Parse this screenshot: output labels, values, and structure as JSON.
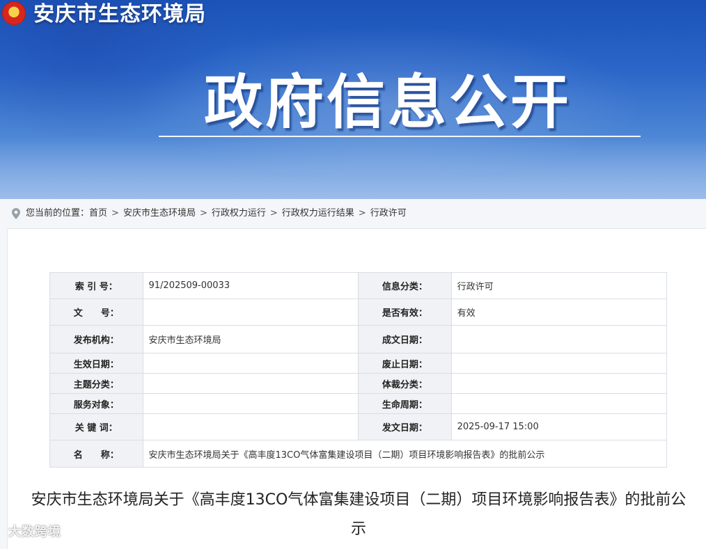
{
  "header": {
    "site_title": "安庆市生态环境局",
    "banner_title": "政府信息公开"
  },
  "breadcrumb": {
    "prefix": "您当前的位置：",
    "items": [
      "首页",
      "安庆市生态环境局",
      "行政权力运行",
      "行政权力运行结果",
      "行政许可"
    ],
    "separator": ">"
  },
  "meta": {
    "rows": [
      {
        "k1": "索 引 号：",
        "v1": "91/202509-00033",
        "k2": "信息分类：",
        "v2": "行政许可"
      },
      {
        "k1": "文　　号：",
        "v1": "",
        "k2": "是否有效：",
        "v2": "有效"
      },
      {
        "k1": "发布机构：",
        "v1": "安庆市生态环境局",
        "k2": "成文日期：",
        "v2": ""
      },
      {
        "k1": "生效日期：",
        "v1": "",
        "k2": "废止日期：",
        "v2": ""
      },
      {
        "k1": "主题分类：",
        "v1": "",
        "k2": "体裁分类：",
        "v2": ""
      },
      {
        "k1": "服务对象：",
        "v1": "",
        "k2": "生命周期：",
        "v2": ""
      },
      {
        "k1": "关 键 词：",
        "v1": "",
        "k2": "发文日期：",
        "v2": "2025-09-17 15:00"
      }
    ],
    "name_label": "名　　称：",
    "name_value": "安庆市生态环境局关于《高丰度13CO气体富集建设项目（二期）项目环境影响报告表》的批前公示"
  },
  "document": {
    "title": "安庆市生态环境局关于《高丰度13CO气体富集建设项目（二期）项目环境影响报告表》的批前公示"
  },
  "watermark": "大数跨境",
  "colors": {
    "banner_blue": "#2a66c8",
    "label_bg": "#f0f2f5",
    "border": "#d9dde3"
  }
}
